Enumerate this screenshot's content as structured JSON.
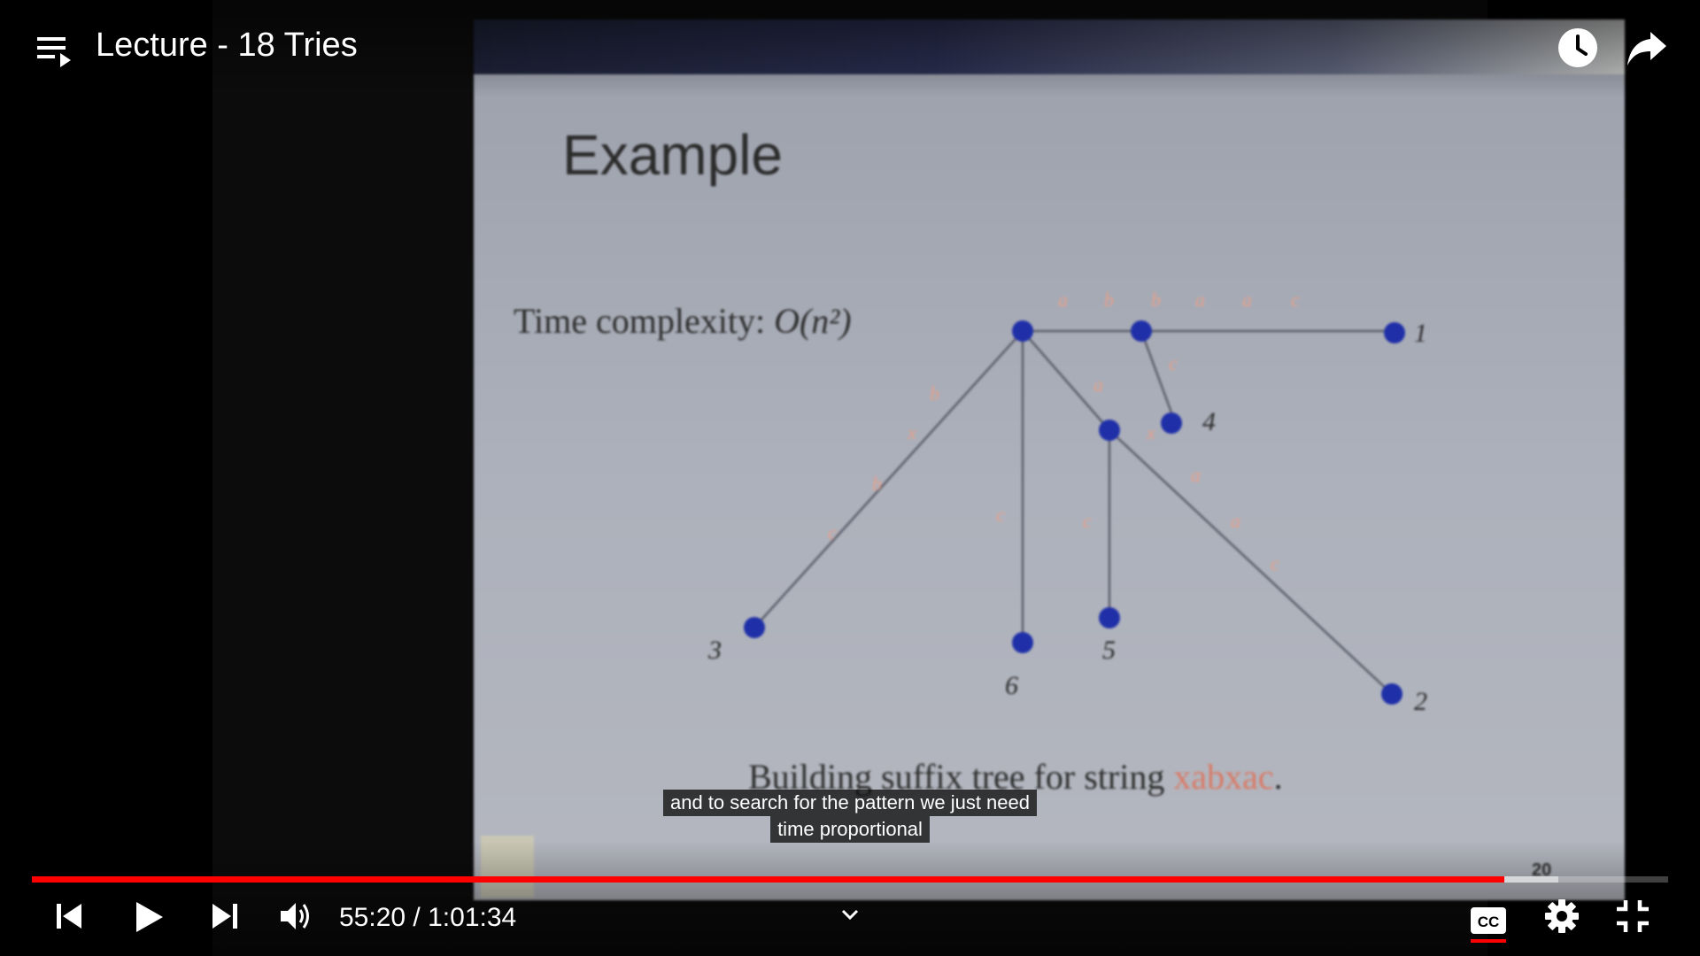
{
  "player": {
    "title": "Lecture - 18 Tries",
    "current_time": "55:20",
    "separator": "/",
    "duration": "1:01:34",
    "progress_fraction": 0.9,
    "buffer_fraction": 0.933,
    "accent_color": "#ff0000",
    "captions_enabled": true,
    "caption_lines": [
      "and to search for the pattern we just need",
      "time proportional"
    ]
  },
  "icons": {
    "playlist": "playlist-icon",
    "watch_later": "clock-icon",
    "share": "share-arrow-icon",
    "prev": "skip-previous-icon",
    "play": "play-icon",
    "next": "skip-next-icon",
    "volume": "volume-icon",
    "chevron": "chevron-down-icon",
    "cc": "closed-captions-icon",
    "settings": "gear-icon",
    "exit_fullscreen": "exit-fullscreen-icon"
  },
  "cc_label": "CC",
  "slide": {
    "title": "Example",
    "subtitle_prefix": "Time complexity: ",
    "subtitle_math": "O(n²)",
    "caption_prefix": "Building suffix tree for string ",
    "caption_word": "xabxac",
    "caption_suffix": ".",
    "page": "20",
    "leaf_labels": [
      "1",
      "4",
      "3",
      "6",
      "5",
      "2"
    ]
  }
}
